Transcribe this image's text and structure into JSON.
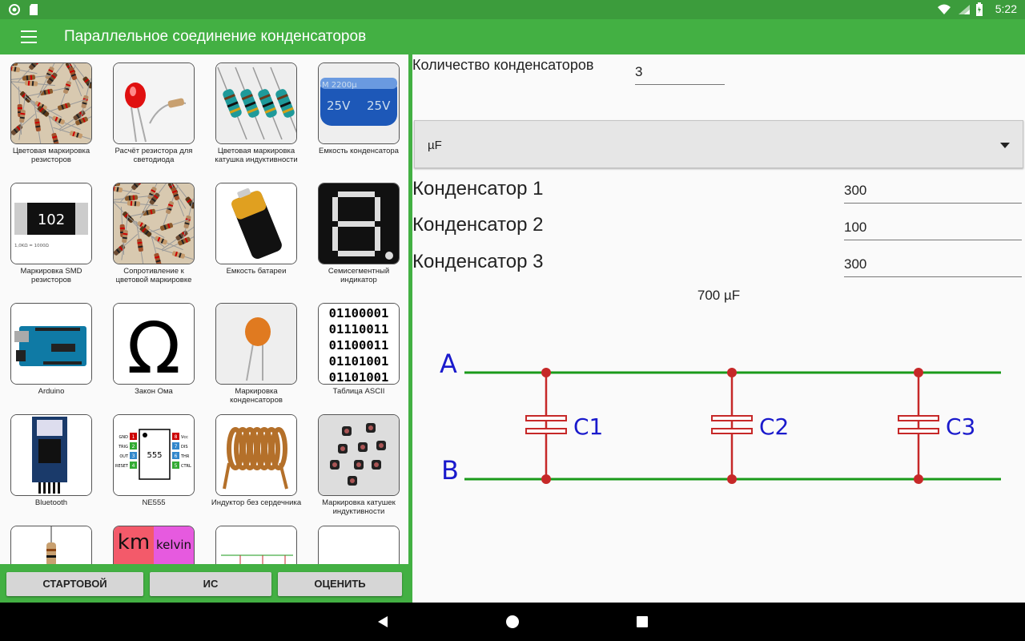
{
  "status": {
    "time": "5:22"
  },
  "appbar": {
    "title": "Параллельное соединение конденсаторов"
  },
  "tiles": [
    {
      "label": "Цветовая маркировка резисторов",
      "icon": "resistors-photo"
    },
    {
      "label": "Расчёт резистора для светодиода",
      "icon": "led-resistor-photo"
    },
    {
      "label": "Цветовая маркировка катушка индуктивности",
      "icon": "inductor-coils-photo"
    },
    {
      "label": "Емкость конденсатора",
      "icon": "capacitor-photo"
    },
    {
      "label": "Маркировка SMD резисторов",
      "icon": "smd-resistor-icon",
      "smd_code": "102",
      "smd_note": "1,0KΩ = 1000Ω"
    },
    {
      "label": "Сопротивление к цветовой маркировке",
      "icon": "resistors-photo"
    },
    {
      "label": "Емкость батареи",
      "icon": "battery-icon"
    },
    {
      "label": "Семисегментный индикатор",
      "icon": "seven-segment-icon"
    },
    {
      "label": "Arduino",
      "icon": "arduino-icon"
    },
    {
      "label": "Закон Ома",
      "icon": "omega-icon",
      "glyph": "Ω"
    },
    {
      "label": "Маркировка конденсаторов",
      "icon": "ceramic-capacitor-icon"
    },
    {
      "label": "Таблица ASCII",
      "icon": "ascii-icon",
      "lines": [
        "01100001",
        "01110011",
        "01100011",
        "01101001",
        "01101001"
      ]
    },
    {
      "label": "Bluetooth",
      "icon": "bluetooth-module-icon"
    },
    {
      "label": "NE555",
      "icon": "ne555-icon",
      "chip": "555",
      "pins_left": [
        "GND",
        "TRIG",
        "OUT",
        "RESET"
      ],
      "pins_right": [
        "Vcc",
        "DIS",
        "THR",
        "CTRL"
      ],
      "nums_left": [
        "1",
        "2",
        "3",
        "4"
      ],
      "nums_right": [
        "8",
        "7",
        "6",
        "5"
      ]
    },
    {
      "label": "Индуктор без сердечника",
      "icon": "air-coil-icon"
    },
    {
      "label": "Маркировка катушек индуктивности",
      "icon": "smd-inductors-icon"
    },
    {
      "label": "",
      "icon": "resistor-icon"
    },
    {
      "label": "",
      "icon": "unit-converter-icon",
      "km": "km",
      "kelvin": "kelvin"
    },
    {
      "label": "",
      "icon": "circuit-icon"
    },
    {
      "label": "",
      "icon": "blank-icon"
    }
  ],
  "bottom_buttons": [
    "СТАРТОВОЙ",
    "ИС",
    "ОЦЕНИТЬ"
  ],
  "form": {
    "count_label": "Количество конденсаторов",
    "count_value": "3",
    "unit": "µF",
    "capacitors": [
      {
        "label": "Конденсатор 1",
        "value": "300"
      },
      {
        "label": "Конденсатор 2",
        "value": "100"
      },
      {
        "label": "Конденсатор 3",
        "value": "300"
      }
    ],
    "result": "700 µF"
  },
  "diagram": {
    "node_a": "A",
    "node_b": "B",
    "caps": [
      "C1",
      "C2",
      "C3"
    ],
    "wire_color": "#1a9a1a",
    "cap_color": "#c62828",
    "label_color": "#1a1acc"
  }
}
